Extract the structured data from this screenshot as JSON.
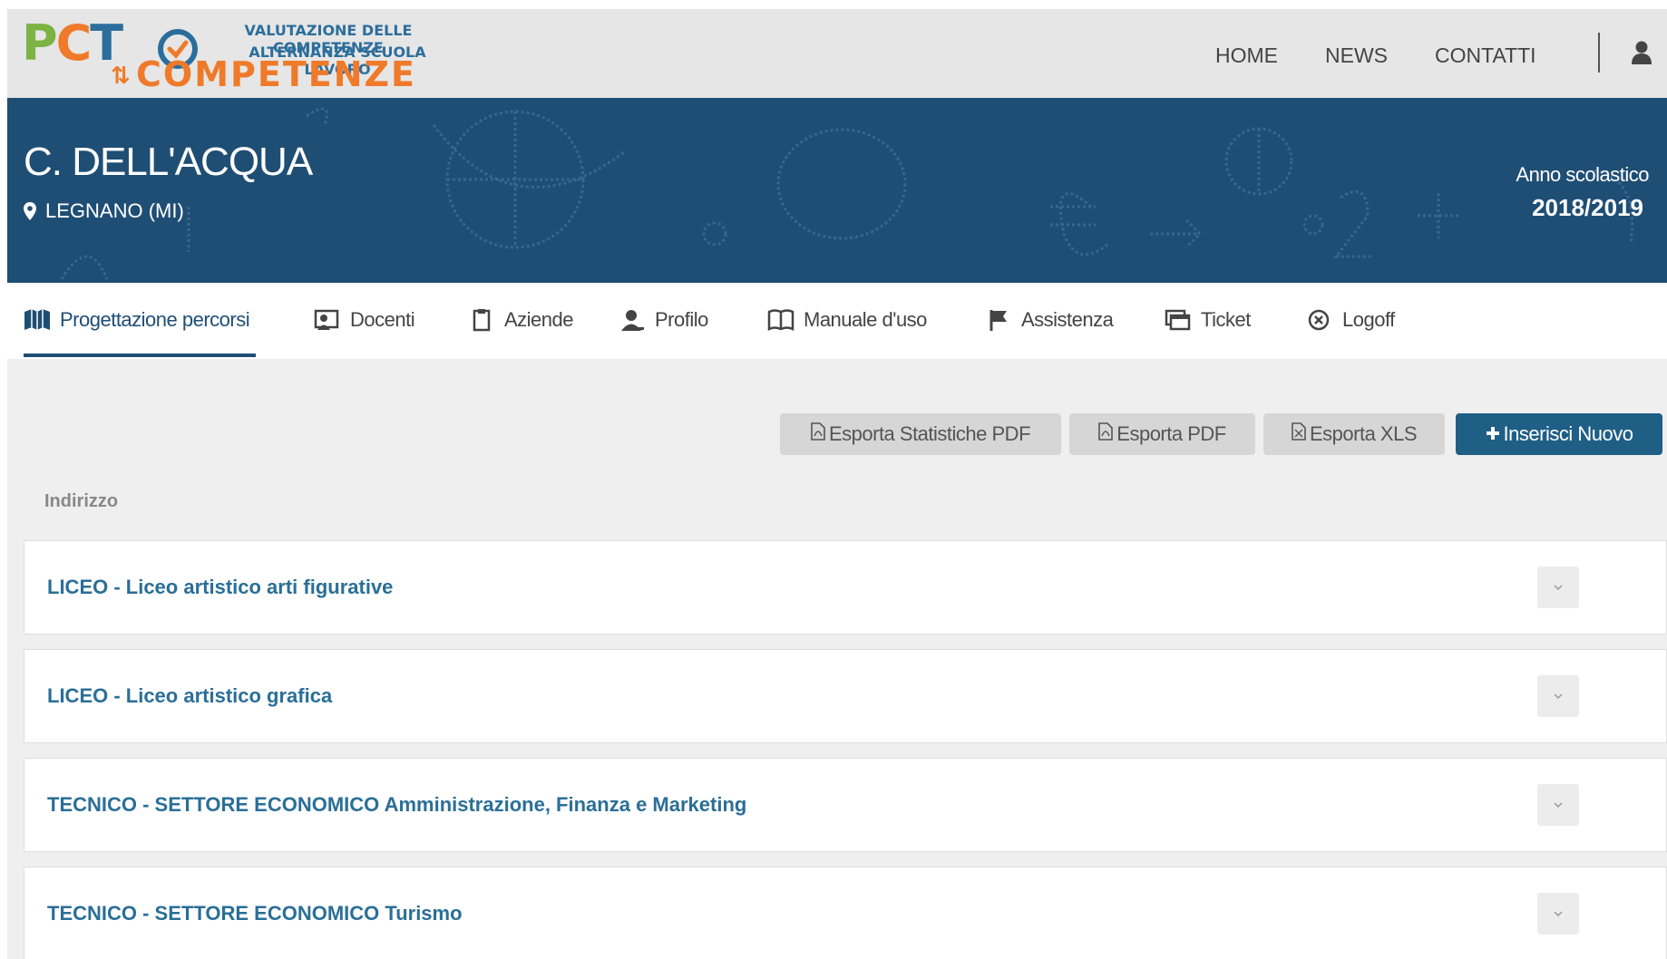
{
  "header": {
    "logo": {
      "pcto": "PCTO",
      "tagline_1": "VALUTAZIONE DELLE COMPETENZE",
      "tagline_2": "ALTERNANZA SCUOLA LAVORO",
      "competenze": "COMPETENZE"
    },
    "nav": [
      {
        "label": "HOME"
      },
      {
        "label": "NEWS"
      },
      {
        "label": "CONTATTI"
      }
    ],
    "user_icon": "user-icon"
  },
  "banner": {
    "school_name": "C. DELL'ACQUA",
    "location": "LEGNANO (MI)",
    "year_label": "Anno scolastico",
    "year_value": "2018/2019"
  },
  "tabs": [
    {
      "label": "Progettazione percorsi",
      "icon": "map-icon",
      "active": true
    },
    {
      "label": "Docenti",
      "icon": "teacher-icon",
      "active": false
    },
    {
      "label": "Aziende",
      "icon": "clipboard-icon",
      "active": false
    },
    {
      "label": "Profilo",
      "icon": "user-edit-icon",
      "active": false
    },
    {
      "label": "Manuale d'uso",
      "icon": "book-icon",
      "active": false
    },
    {
      "label": "Assistenza",
      "icon": "flag-icon",
      "active": false
    },
    {
      "label": "Ticket",
      "icon": "windows-icon",
      "active": false
    },
    {
      "label": "Logoff",
      "icon": "close-circle-icon",
      "active": false
    }
  ],
  "actions": {
    "export_stats_pdf": "Esporta Statistiche PDF",
    "export_pdf": "Esporta PDF",
    "export_xls": "Esporta XLS",
    "insert_new": "Inserisci Nuovo"
  },
  "list": {
    "header": "Indirizzo",
    "items": [
      {
        "label": "LICEO - Liceo artistico arti figurative"
      },
      {
        "label": "LICEO - Liceo artistico grafica"
      },
      {
        "label": "TECNICO - SETTORE ECONOMICO Amministrazione, Finanza e Marketing"
      },
      {
        "label": "TECNICO - SETTORE ECONOMICO Turismo"
      }
    ]
  },
  "colors": {
    "brand_blue": "#1f4e75",
    "link_blue": "#2a6f97",
    "primary_button": "#1f5f86",
    "logo_orange": "#ef7a2a",
    "logo_green": "#7cb342"
  }
}
